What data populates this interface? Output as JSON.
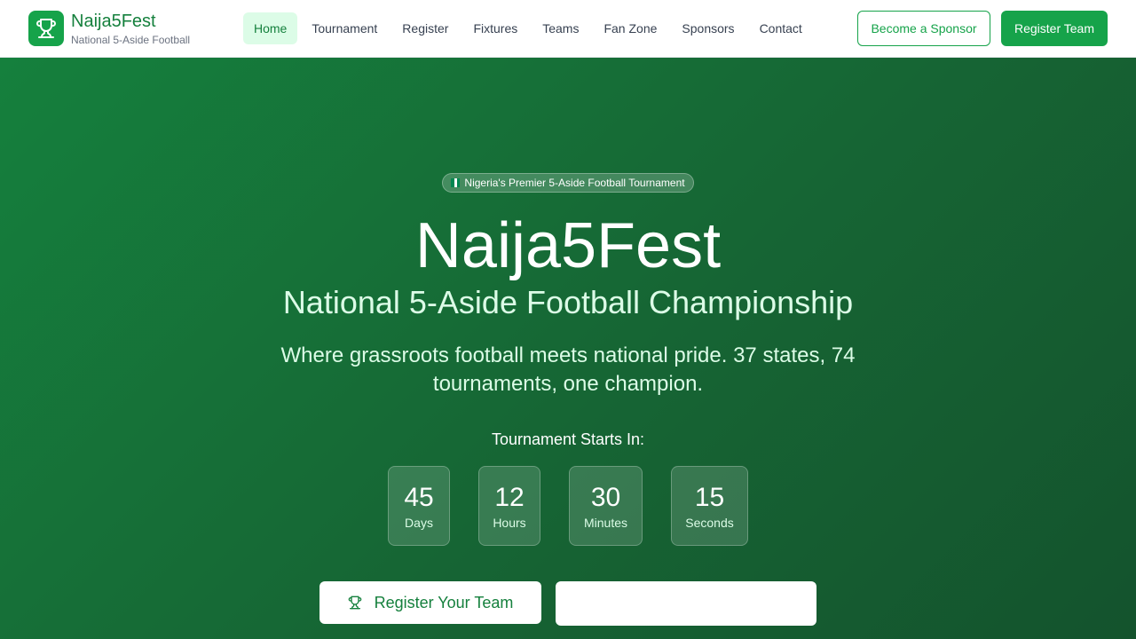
{
  "brand": {
    "name": "Naija5Fest",
    "tagline": "National 5-Aside Football",
    "logo_icon": "trophy-icon"
  },
  "nav": {
    "items": [
      "Home",
      "Tournament",
      "Register",
      "Fixtures",
      "Teams",
      "Fan Zone",
      "Sponsors",
      "Contact"
    ],
    "active": "Home"
  },
  "header_actions": {
    "sponsor_label": "Become a Sponsor",
    "register_label": "Register Team"
  },
  "hero": {
    "badge": "Nigeria's Premier 5-Aside Football Tournament",
    "badge_icon": "nigeria-flag-icon",
    "title": "Naija5Fest",
    "subtitle": "National 5-Aside Football Championship",
    "description": "Where grassroots football meets national pride. 37 states, 74 tournaments, one champion.",
    "countdown_label": "Tournament Starts In:",
    "countdown": [
      {
        "value": "45",
        "unit": "Days"
      },
      {
        "value": "12",
        "unit": "Hours"
      },
      {
        "value": "30",
        "unit": "Minutes"
      },
      {
        "value": "15",
        "unit": "Seconds"
      }
    ],
    "cta_primary": "Register Your Team",
    "cta_primary_icon": "trophy-icon",
    "cta_secondary": ""
  },
  "colors": {
    "brand_green": "#16a34a",
    "dark_green": "#15803d",
    "hero_gradient_start": "#15803d",
    "hero_gradient_end": "#14532d",
    "active_nav_bg": "#dcfce7"
  }
}
